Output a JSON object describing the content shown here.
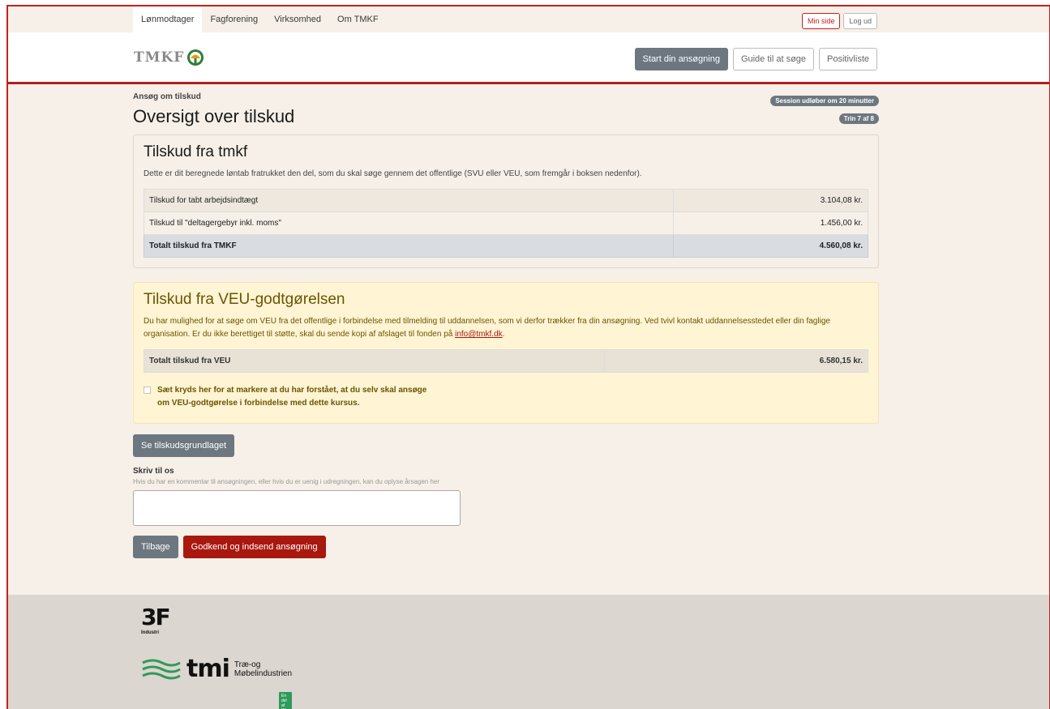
{
  "nav": {
    "items": [
      {
        "label": "Lønmodtager",
        "active": true
      },
      {
        "label": "Fagforening",
        "active": false
      },
      {
        "label": "Virksomhed",
        "active": false
      },
      {
        "label": "Om TMKF",
        "active": false
      }
    ],
    "min_side": "Min side",
    "log_ud": "Log ud"
  },
  "header": {
    "logo_text": "TMKF",
    "start_label": "Start din ansøgning",
    "guide_label": "Guide til at søge",
    "positiv_label": "Positivliste"
  },
  "page": {
    "breadcrumb": "Ansøg om tilskud",
    "title": "Oversigt over tilskud",
    "session_badge": "Session udløber om 20 minutter",
    "step_badge": "Trin 7 af 8"
  },
  "tmkf": {
    "title": "Tilskud fra tmkf",
    "description": "Dette er dit beregnede løntab fratrukket den del, som du skal søge gennem det offentlige (SVU eller VEU, som fremgår i boksen nedenfor).",
    "rows": [
      {
        "label": "Tilskud for tabt arbejdsindtægt",
        "value": "3.104,08 kr."
      },
      {
        "label": "Tilskud til \"deltagergebyr inkl. moms\"",
        "value": "1.456,00 kr."
      }
    ],
    "total_label": "Totalt tilskud fra TMKF",
    "total_value": "4.560,08 kr."
  },
  "veu": {
    "title": "Tilskud fra VEU-godtgørelsen",
    "description": "Du har mulighed for at søge om VEU fra det offentlige i forbindelse med tilmelding til uddannelsen, som vi derfor trækker fra din ansøgning. Ved tvivl kontakt uddannelsesstedet eller din faglige organisation. Er du ikke berettiget til støtte, skal du sende kopi af afslaget til fonden på",
    "email": "info@tmkf.dk",
    "description_end": ".",
    "total_label": "Totalt tilskud fra VEU",
    "total_value": "6.580,15 kr.",
    "checkbox_line1": "Sæt kryds her for at markere at du har forstået, at du selv skal ansøge",
    "checkbox_line2": "om VEU-godtgørelse i forbindelse med dette kursus."
  },
  "actions": {
    "grundlag_label": "Se tilskudsgrundlaget",
    "write_label": "Skriv til os",
    "write_hint": "Hvis du har en kommentar til ansøgningen, eller hvis du er uenig i udregningen, kan du oplyse årsagen her",
    "back_label": "Tilbage",
    "submit_label": "Godkend og indsend ansøgning"
  },
  "footer": {
    "logo_3f": "3F",
    "logo_3f_sub": "Industri",
    "tmi_word": "tmi",
    "tmi_line1": "Træ-og",
    "tmi_line2": "Møbelindustrien",
    "tmi_tag": "En del af DI"
  },
  "colors": {
    "brand_red": "#a8180f",
    "button_gray": "#6c7780",
    "page_bg": "#f6f0e8",
    "veu_bg": "#fff4d4"
  }
}
